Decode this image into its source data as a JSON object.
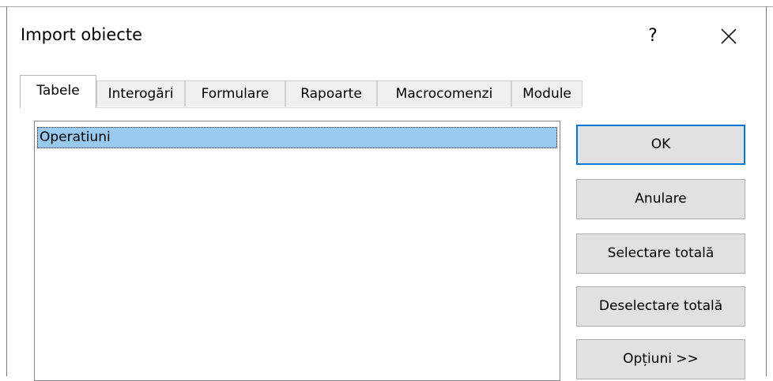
{
  "dialog": {
    "title": "Import obiecte",
    "help_label": "?",
    "close_icon": "close-icon"
  },
  "tabs": [
    {
      "label": "Tabele",
      "active": true
    },
    {
      "label": "Interogări",
      "active": false
    },
    {
      "label": "Formulare",
      "active": false
    },
    {
      "label": "Rapoarte",
      "active": false
    },
    {
      "label": "Macrocomenzi",
      "active": false
    },
    {
      "label": "Module",
      "active": false
    }
  ],
  "list": {
    "items": [
      {
        "label": "Operatiuni",
        "selected": true
      }
    ]
  },
  "buttons": {
    "ok": "OK",
    "cancel": "Anulare",
    "select_all": "Selectare totală",
    "deselect_all": "Deselectare totală",
    "options": "Opțiuni >>"
  },
  "colors": {
    "selection": "#99c9ef",
    "default_button_border": "#0078d7",
    "button_face": "#e1e1e1"
  }
}
